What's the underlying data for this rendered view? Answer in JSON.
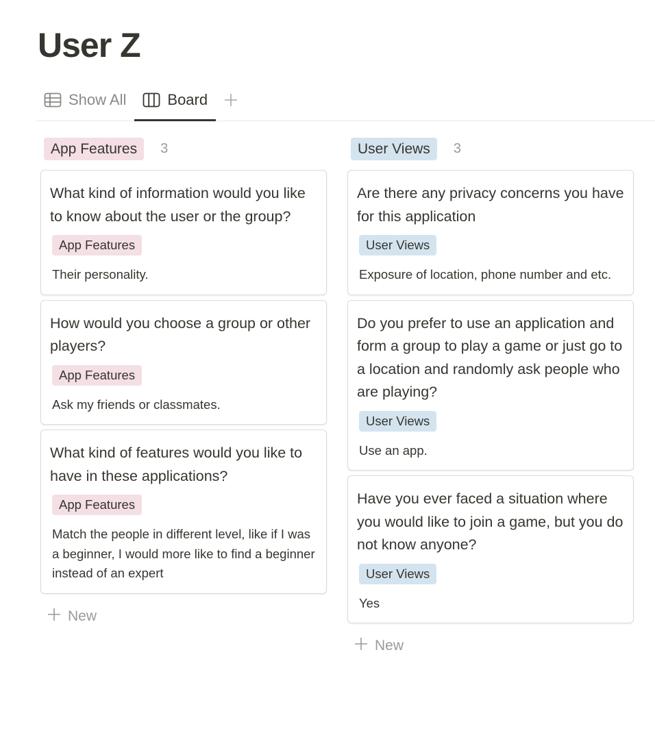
{
  "page": {
    "title": "User Z"
  },
  "tabs": [
    {
      "label": "Show All",
      "icon": "table-icon"
    },
    {
      "label": "Board",
      "icon": "board-icon"
    }
  ],
  "colors": {
    "pink_tag": "#f4dfe5",
    "blue_tag": "#d3e4ef",
    "text": "#37352f",
    "muted": "#9b9a97"
  },
  "columns": [
    {
      "label": "App Features",
      "count": "3",
      "new_label": "New",
      "cards": [
        {
          "title": "What kind of information would you like to know about the user or the group?",
          "tag": "App Features",
          "body": "Their personality."
        },
        {
          "title": " How would you choose a group or other players?",
          "tag": "App Features",
          "body": "Ask my friends or classmates."
        },
        {
          "title": "What kind of features would you like to have in these applications?",
          "tag": "App Features",
          "body": "Match the people in different level, like if I was a beginner, I would more like to find a beginner instead of an expert"
        }
      ]
    },
    {
      "label": "User Views",
      "count": "3",
      "new_label": "New",
      "cards": [
        {
          "title": " Are there any privacy concerns you have for this application",
          "tag": "User Views",
          "body": "Exposure of location, phone number and etc."
        },
        {
          "title": " Do you prefer to use an application and form a group to play a game or just go to a location and randomly ask people who are playing?",
          "tag": "User Views",
          "body": "Use an app."
        },
        {
          "title": "Have you ever faced a situation where you would like to join a game, but you do not know anyone?",
          "tag": "User Views",
          "body": "Yes"
        }
      ]
    }
  ]
}
